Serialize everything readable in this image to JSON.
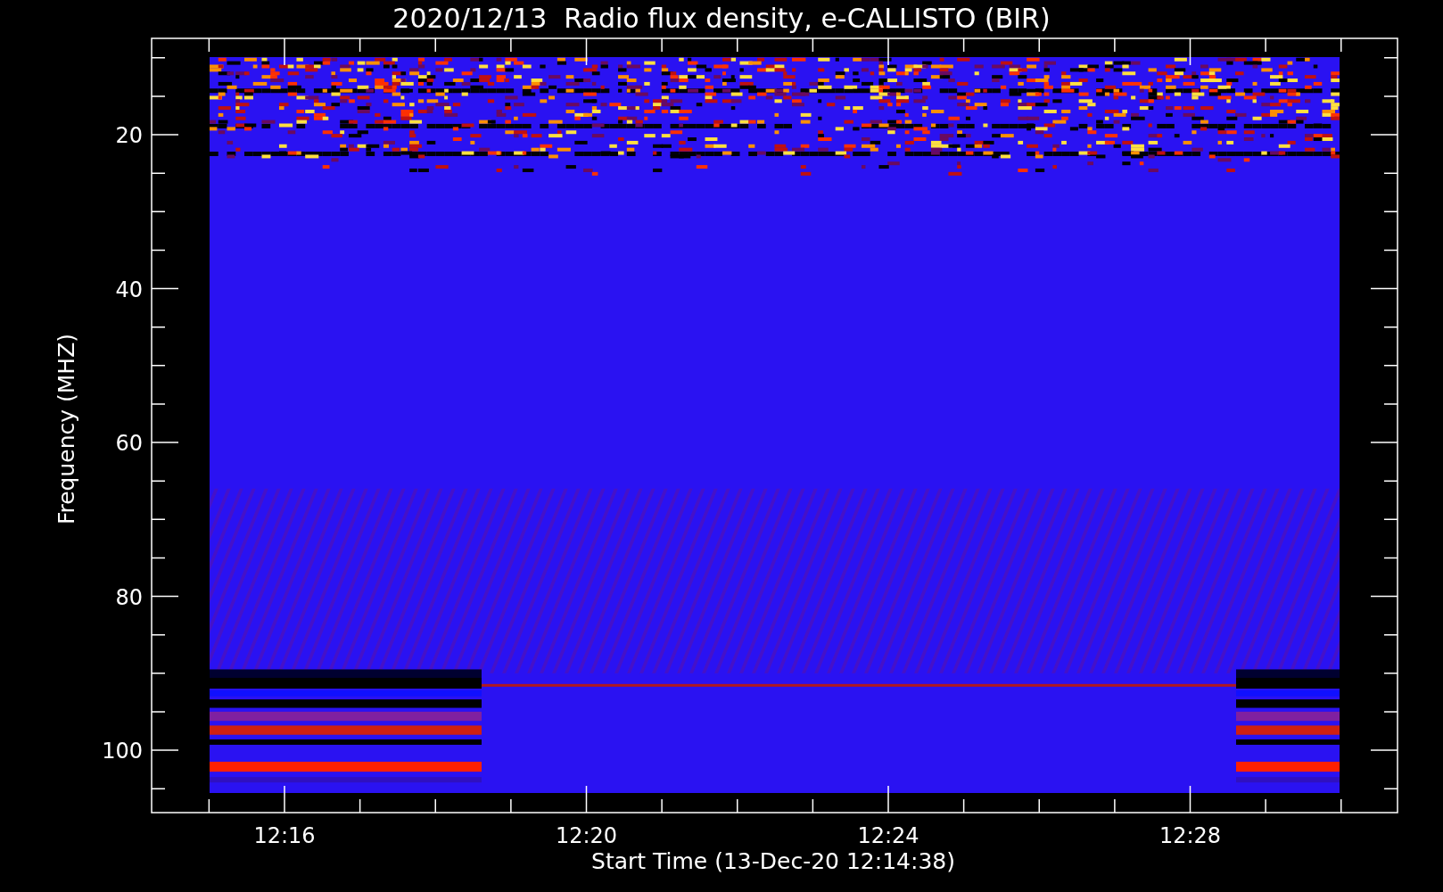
{
  "title": "2020/12/13  Radio flux density, e-CALLISTO (BIR)",
  "y_axis": {
    "label": "Frequency (MHZ)",
    "ticks": [
      "20",
      "40",
      "60",
      "80",
      "100"
    ]
  },
  "x_axis": {
    "label": "Start Time (13-Dec-20 12:14:38)",
    "ticks": [
      "12:16",
      "12:20",
      "12:24",
      "12:28"
    ]
  }
}
